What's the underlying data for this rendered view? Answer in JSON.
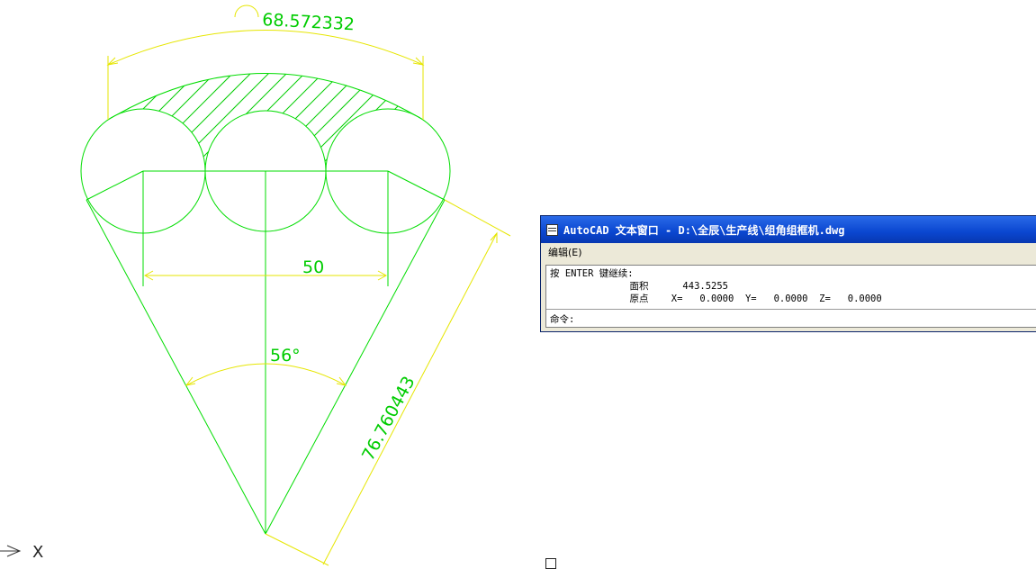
{
  "drawing": {
    "dim_arc_length": "68.572332",
    "dim_width": "50",
    "dim_angle": "56°",
    "dim_side": "76.760443",
    "ucs_axis_label": "X"
  },
  "text_window": {
    "title": "AutoCAD 文本窗口 - D:\\全辰\\生产线\\组角组框机.dwg",
    "menu_edit": "编辑(E)",
    "line1": "按 ENTER 键继续:",
    "line2": "              面积      443.5255",
    "line3": "              原点    X=   0.0000  Y=   0.0000  Z=   0.0000",
    "command_prompt": "命令:"
  },
  "colors": {
    "geometry": "#00dd00",
    "dimensions": "#e6e600",
    "titlebar": "#0a46d0"
  }
}
